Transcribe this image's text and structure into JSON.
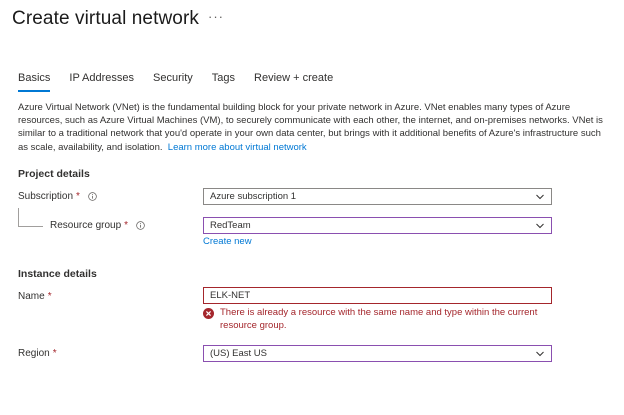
{
  "header": {
    "title": "Create virtual network",
    "more": "···"
  },
  "tabs": [
    {
      "label": "Basics",
      "active": true
    },
    {
      "label": "IP Addresses",
      "active": false
    },
    {
      "label": "Security",
      "active": false
    },
    {
      "label": "Tags",
      "active": false
    },
    {
      "label": "Review + create",
      "active": false
    }
  ],
  "description": {
    "text": "Azure Virtual Network (VNet) is the fundamental building block for your private network in Azure. VNet enables many types of Azure resources, such as Azure Virtual Machines (VM), to securely communicate with each other, the internet, and on-premises networks. VNet is similar to a traditional network that you'd operate in your own data center, but brings with it additional benefits of Azure's infrastructure such as scale, availability, and isolation.",
    "link": "Learn more about virtual network"
  },
  "project_details": {
    "heading": "Project details",
    "subscription": {
      "label": "Subscription",
      "required": "*",
      "value": "Azure subscription 1"
    },
    "resource_group": {
      "label": "Resource group",
      "required": "*",
      "value": "RedTeam",
      "create_new": "Create new"
    }
  },
  "instance_details": {
    "heading": "Instance details",
    "name": {
      "label": "Name",
      "required": "*",
      "value": "ELK-NET",
      "error": "There is already a resource with the same name and type within the current resource group."
    },
    "region": {
      "label": "Region",
      "required": "*",
      "value": "(US) East US"
    }
  },
  "colors": {
    "accent": "#0078d4",
    "error": "#a4262c",
    "focus_border": "#8a4fb0"
  },
  "icons": [
    "more-icon",
    "info-icon",
    "chevron-down-icon",
    "error-icon"
  ]
}
